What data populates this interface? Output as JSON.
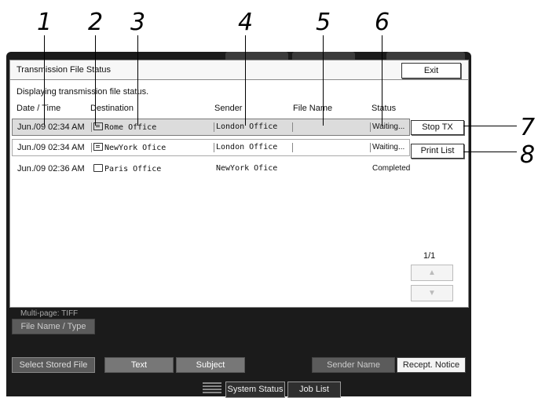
{
  "callouts": [
    "1",
    "2",
    "3",
    "4",
    "5",
    "6",
    "7",
    "8"
  ],
  "window": {
    "title": "Transmission File Status",
    "exit_label": "Exit",
    "message": "Displaying transmission file status."
  },
  "columns": [
    "Date / Time",
    "Destination",
    "Sender",
    "File Name",
    "Status"
  ],
  "rows": [
    {
      "datetime": "Jun./09 02:34 AM",
      "destination": "Rome Office",
      "sender": "London Office",
      "file_name": "",
      "status": "Waiting...",
      "icon": "fax-icon"
    },
    {
      "datetime": "Jun./09 02:34 AM",
      "destination": "NewYork Ofice",
      "sender": "London Office",
      "file_name": "",
      "status": "Waiting...",
      "icon": "fax-icon"
    },
    {
      "datetime": "Jun./09 02:36 AM",
      "destination": "Paris Office",
      "sender": "NewYork Ofice",
      "file_name": "",
      "status": "Completed",
      "icon": "folder-icon"
    }
  ],
  "side_buttons": {
    "stop_tx": "Stop TX",
    "print_list": "Print List"
  },
  "pager": {
    "text": "1/1",
    "up": "▲",
    "down": "▼"
  },
  "lower": {
    "multipage": "Multi-page: TIFF",
    "file_name_type": "File Name / Type",
    "select_stored_file": "Select Stored File",
    "text": "Text",
    "subject": "Subject",
    "sender_name": "Sender Name",
    "recept_notice": "Recept. Notice"
  },
  "bottom": {
    "system_status": "System Status",
    "job_list": "Job List"
  }
}
